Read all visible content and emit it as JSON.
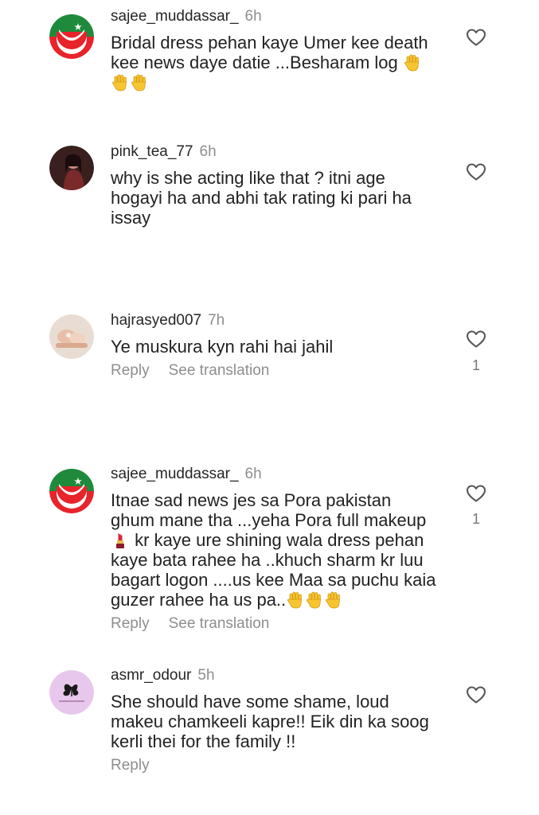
{
  "comments": [
    {
      "avatar_icon": "pti-flag-avatar-icon",
      "username": "sajee_muddassar_",
      "time": "6h",
      "text_line1": "Bridal dress pehan kaye Umer kee death",
      "text_line2": "kee news daye datie ...Besharam log",
      "reply": "",
      "see_translation": "",
      "likes": ""
    },
    {
      "avatar_icon": "profile-photo-avatar-icon",
      "username": "pink_tea_77",
      "time": "6h",
      "text_line1": "why is she acting like that ? itni age",
      "text_line2": "hogayi ha and abhi tak rating ki pari ha",
      "text_line3": "issay",
      "reply": "",
      "see_translation": "",
      "likes": ""
    },
    {
      "avatar_icon": "profile-photo-avatar-icon",
      "username": "hajrasyed007",
      "time": "7h",
      "text_line1": "Ye muskura kyn rahi hai jahil",
      "reply": "Reply",
      "see_translation": "See translation",
      "likes": "1"
    },
    {
      "avatar_icon": "pti-flag-avatar-icon",
      "username": "sajee_muddassar_",
      "time": "6h",
      "text_line1": "Itnae sad news jes sa Pora pakistan",
      "text_line2": "ghum mane tha ...yeha Pora full makeup",
      "text_line3": "kr kaye ure shining wala dress pehan",
      "text_line4": "kaye bata rahee ha ..khuch sharm kr luu",
      "text_line5": "bagart logon ....us kee Maa sa puchu kaia",
      "text_line6": "guzer rahee ha us pa..",
      "reply": "Reply",
      "see_translation": "See translation",
      "likes": "1"
    },
    {
      "avatar_icon": "butterfly-avatar-icon",
      "username": "asmr_odour",
      "time": "5h",
      "text_line1": "She should have some shame, loud",
      "text_line2": "makeu chamkeeli kapre!! Eik din ka soog",
      "text_line3": "kerli thei for the family !!",
      "reply": "Reply",
      "see_translation": "",
      "likes": ""
    }
  ],
  "colors": {
    "pti_red": "#e8232a",
    "pti_green": "#1f8a3b",
    "secondary_text": "#8e8e8e"
  }
}
